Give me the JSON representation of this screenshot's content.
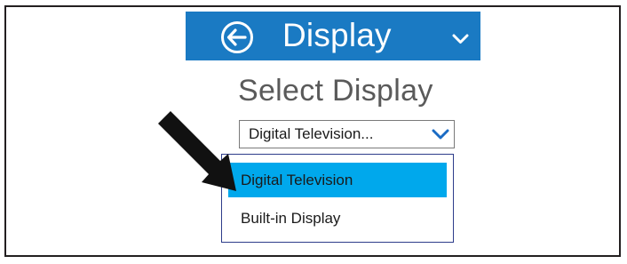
{
  "header": {
    "title": "Display",
    "back_icon": "back-arrow-circle-icon",
    "chevron_icon": "chevron-down-icon",
    "background_color": "#1a7ac3"
  },
  "select_title": "Select Display",
  "combobox": {
    "value": "Digital Television...",
    "chevron_icon": "chevron-down-icon",
    "chevron_color": "#1a6bc4"
  },
  "dropdown": {
    "options": [
      {
        "label": "Digital Television",
        "selected": true
      },
      {
        "label": "Built-in Display",
        "selected": false
      }
    ],
    "highlight_color": "#00a8ec",
    "border_color": "#2d3c8a"
  },
  "annotation": {
    "pointer_icon": "black-arrow-pointer-icon"
  }
}
